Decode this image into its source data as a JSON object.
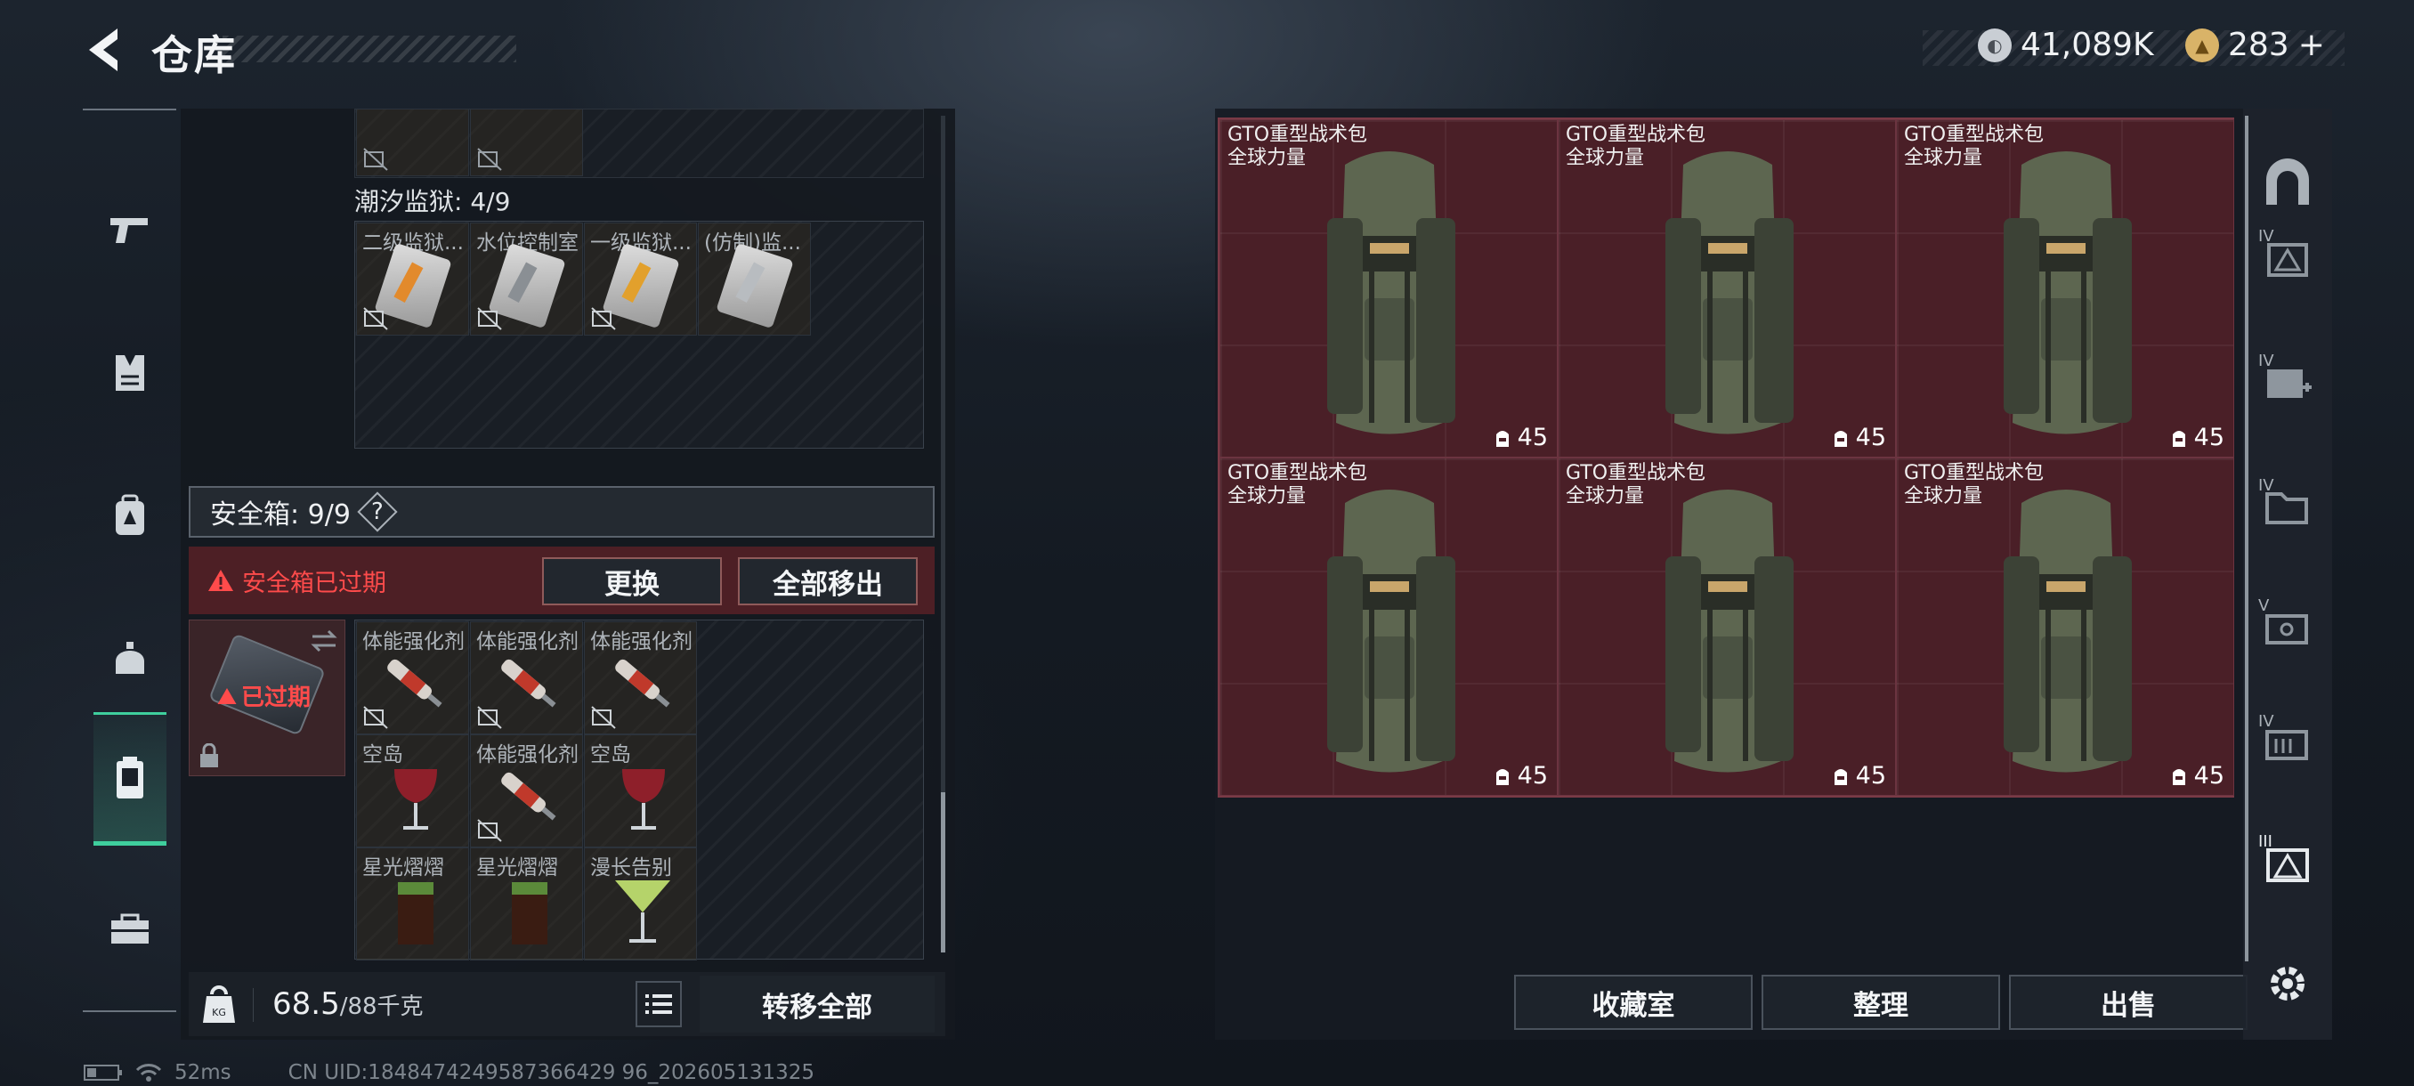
{
  "header": {
    "title": "仓库",
    "currency_silver": "41,089K",
    "currency_gold": "283",
    "gold_plus": "+"
  },
  "left_panel": {
    "top_label": "潮汐监狱: 4/9",
    "tide_items": [
      {
        "label": "二级监狱..."
      },
      {
        "label": "水位控制室"
      },
      {
        "label": "一级监狱..."
      },
      {
        "label": "(仿制)监..."
      }
    ],
    "safe_box": {
      "label": "安全箱: 9/9",
      "help": "?",
      "expired_warning": "安全箱已过期",
      "replace_button": "更换",
      "move_all_button": "全部移出",
      "expired_badge": "已过期"
    },
    "safe_items": [
      {
        "label": "体能强化剂"
      },
      {
        "label": "体能强化剂"
      },
      {
        "label": "体能强化剂"
      },
      {
        "label": "空岛"
      },
      {
        "label": "体能强化剂"
      },
      {
        "label": "空岛"
      },
      {
        "label": "星光熠熠"
      },
      {
        "label": "星光熠熠"
      },
      {
        "label": "漫长告别"
      }
    ],
    "weight": {
      "current": "68.5",
      "max": "/88千克",
      "unit_icon": "KG"
    },
    "transfer_all_button": "转移全部"
  },
  "right_panel": {
    "backpacks": [
      {
        "name": "GTO重型战术包",
        "tag": "全球力量",
        "count": "45"
      },
      {
        "name": "GTO重型战术包",
        "tag": "全球力量",
        "count": "45"
      },
      {
        "name": "GTO重型战术包",
        "tag": "全球力量",
        "count": "45"
      },
      {
        "name": "GTO重型战术包",
        "tag": "全球力量",
        "count": "45"
      },
      {
        "name": "GTO重型战术包",
        "tag": "全球力量",
        "count": "45"
      },
      {
        "name": "GTO重型战术包",
        "tag": "全球力量",
        "count": "45"
      }
    ],
    "buttons": {
      "collection": "收藏室",
      "organize": "整理",
      "sell": "出售"
    },
    "side_labels": {
      "iv1": "IV",
      "iv2": "IV",
      "iv3": "IV",
      "v": "V",
      "iv4": "IV",
      "iii": "III"
    }
  },
  "status": {
    "ping": "52ms",
    "uid": "CN UID:1848474249587366429 96_202605131325"
  },
  "colors": {
    "accent": "#3fcf9d",
    "warning": "#ff4b4b",
    "backpack_bg": "#4a1f27"
  }
}
